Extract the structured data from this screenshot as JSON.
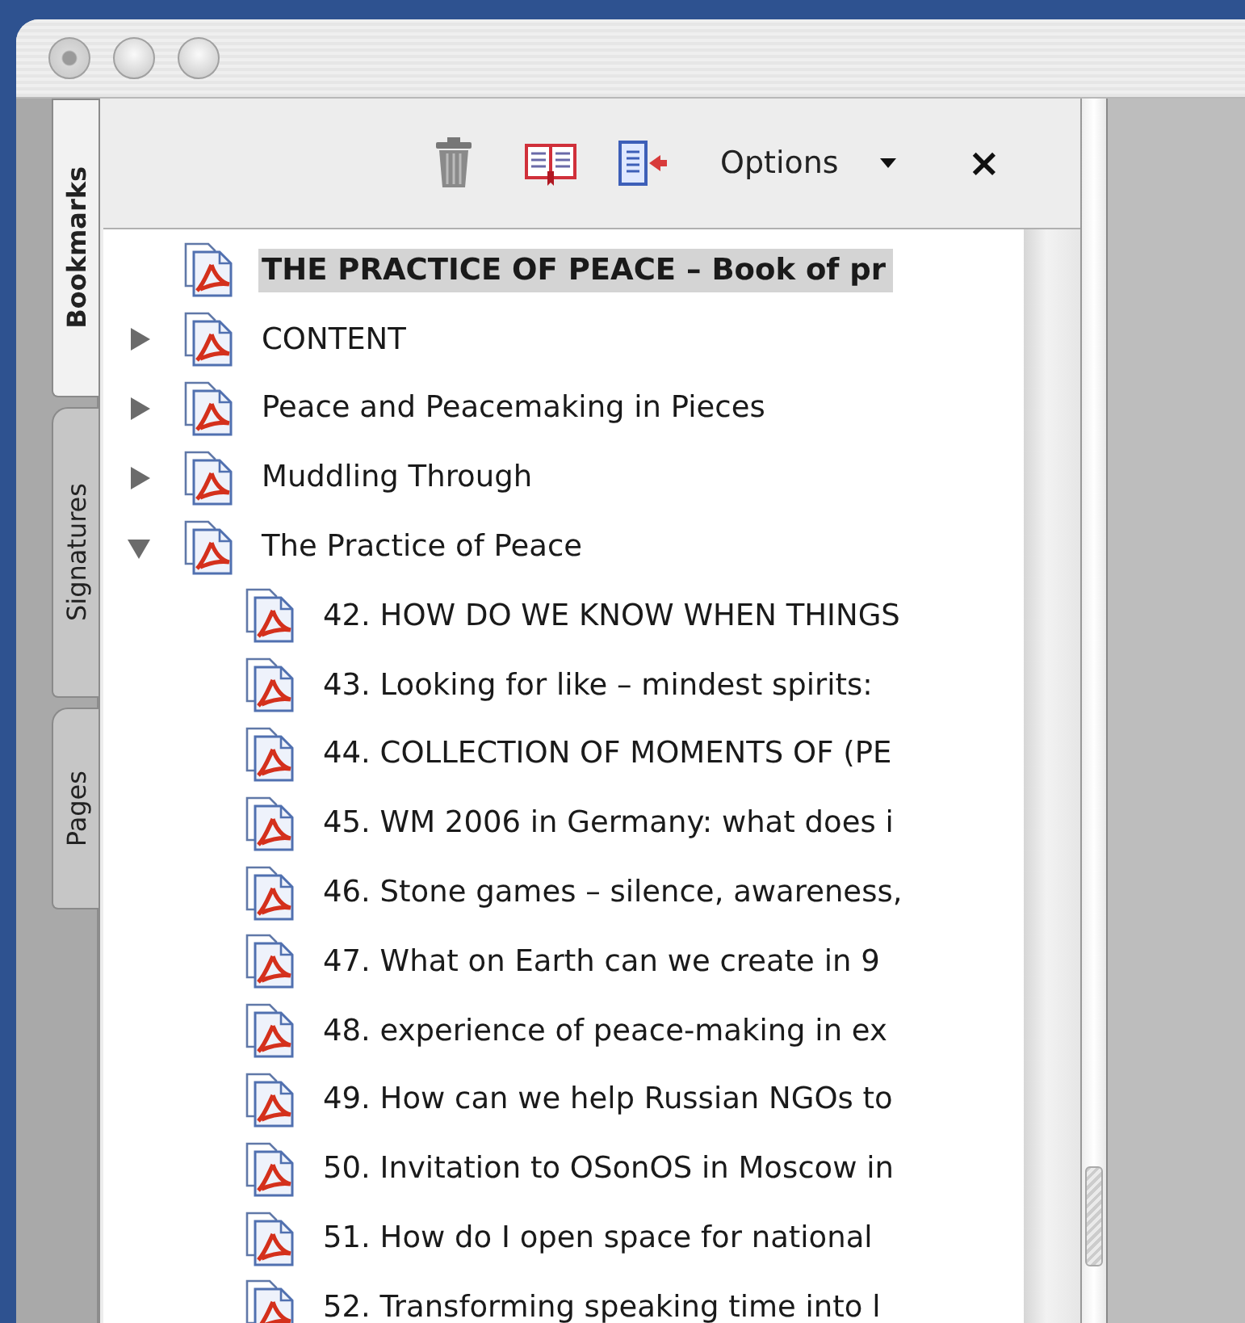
{
  "side_tabs": [
    {
      "label": "Bookmarks",
      "selected": true
    },
    {
      "label": "Signatures",
      "selected": false
    },
    {
      "label": "Pages",
      "selected": false
    }
  ],
  "toolbar": {
    "options_label": "Options",
    "close_label": "×"
  },
  "bookmarks": [
    {
      "label": "THE PRACTICE OF PEACE – Book of pr",
      "selected": true
    },
    {
      "label": "CONTENT",
      "selected": false,
      "expanded": false
    },
    {
      "label": "Peace and Peacemaking in Pieces",
      "selected": false,
      "expanded": false
    },
    {
      "label": "Muddling Through",
      "selected": false,
      "expanded": false
    },
    {
      "label": "The Practice of Peace",
      "selected": false,
      "expanded": true,
      "children": [
        {
          "label": "42. HOW DO WE KNOW WHEN THINGS",
          "selected": false
        },
        {
          "label": "43. Looking for like – mindest spirits:",
          "selected": false
        },
        {
          "label": "44. COLLECTION OF MOMENTS OF (PE",
          "selected": false
        },
        {
          "label": "45. WM 2006 in Germany: what does i",
          "selected": false
        },
        {
          "label": "46. Stone games – silence, awareness,",
          "selected": false
        },
        {
          "label": "47. What on Earth can we create in 9",
          "selected": false
        },
        {
          "label": "48. experience of peace-making in ex",
          "selected": false
        },
        {
          "label": "49. How can we help Russian NGOs to",
          "selected": false
        },
        {
          "label": "50. Invitation to OSonOS in Moscow in",
          "selected": false
        },
        {
          "label": "51. How do I open space for national",
          "selected": false
        },
        {
          "label": "52. Transforming speaking time into l",
          "selected": false
        }
      ]
    }
  ]
}
